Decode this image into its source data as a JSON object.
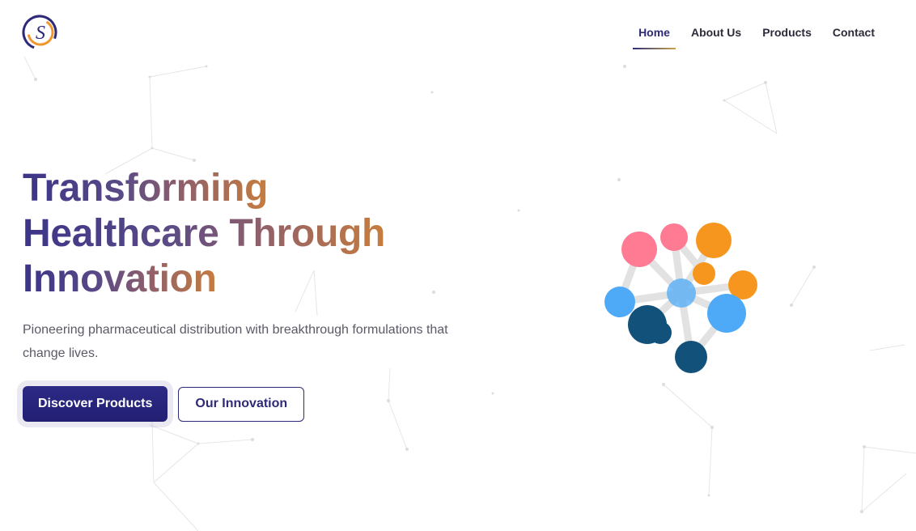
{
  "brand": {
    "logo_letter": "S",
    "logo_icon": "brand-logo-icon",
    "colors": {
      "ring": "#2e2a78",
      "accent": "#f0962a"
    }
  },
  "nav": {
    "items": [
      {
        "label": "Home",
        "active": true
      },
      {
        "label": "About Us",
        "active": false
      },
      {
        "label": "Products",
        "active": false
      },
      {
        "label": "Contact",
        "active": false
      }
    ]
  },
  "hero": {
    "title_line1": "Transforming",
    "title_line2": "Healthcare Through",
    "title_line3": "Innovation",
    "subtitle": "Pioneering pharmaceutical distribution with breakthrough formulations that change lives.",
    "primary_button": "Discover Products",
    "secondary_button": "Our Innovation"
  },
  "illustration": {
    "icon": "molecule-icon",
    "colors": {
      "pink": "#ff7a93",
      "orange": "#f7961e",
      "lightblue": "#4eaaf6",
      "darkblue": "#12527a",
      "bond": "#e2e2e2"
    }
  },
  "colors": {
    "primary": "#2e2a78",
    "title_gradient_start": "#3b3488",
    "title_gradient_end": "#c77d3e",
    "body_text": "#5a5a66"
  }
}
